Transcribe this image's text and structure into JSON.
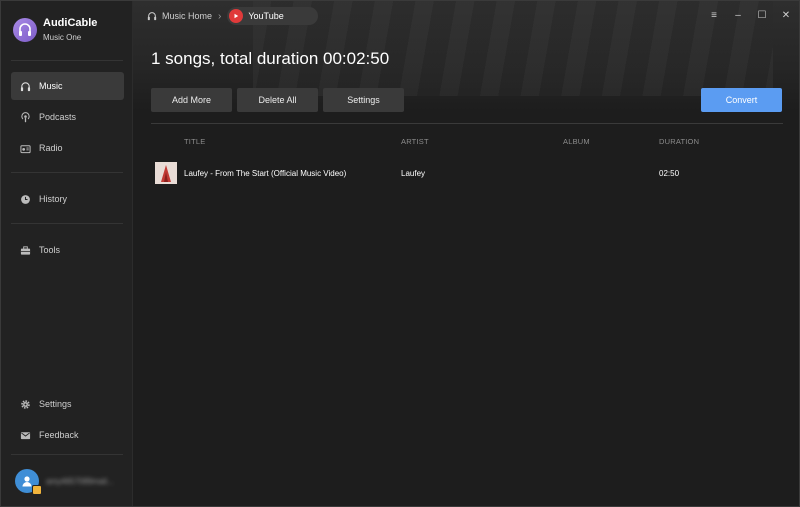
{
  "app": {
    "name": "AudiCable",
    "subtitle": "Music One"
  },
  "sidebar": {
    "items": [
      {
        "label": "Music",
        "icon": "headphones-icon",
        "active": true
      },
      {
        "label": "Podcasts",
        "icon": "podcast-icon"
      },
      {
        "label": "Radio",
        "icon": "radio-icon"
      },
      {
        "label": "History",
        "icon": "clock-icon"
      },
      {
        "label": "Tools",
        "icon": "toolbox-icon"
      }
    ],
    "bottom": [
      {
        "label": "Settings",
        "icon": "gear-icon"
      },
      {
        "label": "Feedback",
        "icon": "mail-icon"
      }
    ],
    "user": {
      "email": "amy4657089mail..."
    }
  },
  "breadcrumb": {
    "home": "Music Home",
    "current": "YouTube"
  },
  "window_controls": [
    "menu-icon",
    "minimize-icon",
    "maximize-icon",
    "close-icon"
  ],
  "main": {
    "summary": "1 songs, total duration 00:02:50",
    "buttons": {
      "add_more": "Add More",
      "delete_all": "Delete All",
      "settings": "Settings",
      "convert": "Convert"
    },
    "columns": {
      "title": "TITLE",
      "artist": "ARTIST",
      "album": "ALBUM",
      "duration": "DURATION"
    },
    "rows": [
      {
        "title": "Laufey - From The Start (Official Music Video)",
        "artist": "Laufey",
        "album": "",
        "duration": "02:50"
      }
    ]
  },
  "colors": {
    "accent": "#5b9cf2",
    "sidebar_bg": "#222222",
    "main_bg": "#1d1d1d",
    "youtube_red": "#e03a3a",
    "logo": "#8f6fd8"
  }
}
